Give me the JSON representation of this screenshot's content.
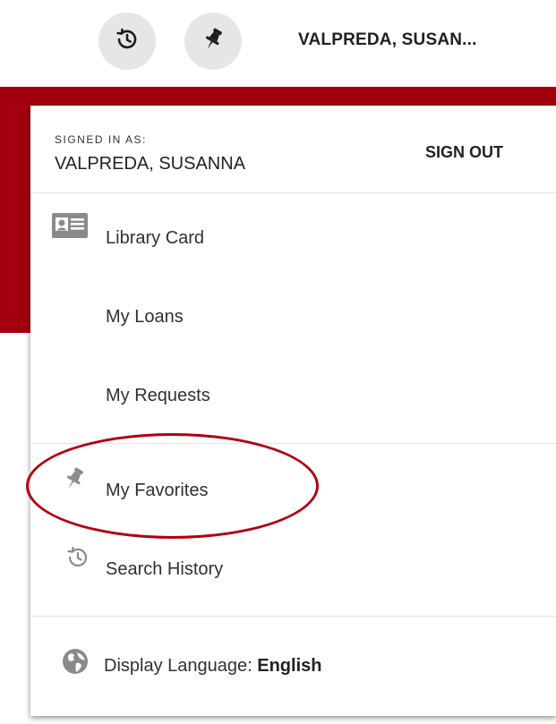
{
  "header": {
    "history_icon": "history-icon",
    "pin_icon": "pin-icon",
    "user_name": "VALPREDA, SUSAN..."
  },
  "account": {
    "signed_in_label": "SIGNED IN AS:",
    "user_full_name": "VALPREDA, SUSANNA",
    "sign_out_label": "SIGN OUT"
  },
  "menu": {
    "items": [
      {
        "label": "Library Card",
        "icon": "id-card-icon"
      },
      {
        "label": "My Loans"
      },
      {
        "label": "My Requests"
      },
      {
        "label": "My Favorites",
        "icon": "pin-icon"
      },
      {
        "label": "Search History",
        "icon": "history-icon"
      }
    ],
    "language": {
      "label": "Display Language:",
      "value": "English",
      "icon": "globe-icon"
    }
  },
  "colors": {
    "brand_red": "#a3000f",
    "annotation_red": "#b00012",
    "icon_gray": "#8a8a8a",
    "button_bg": "#e6e6e6"
  }
}
